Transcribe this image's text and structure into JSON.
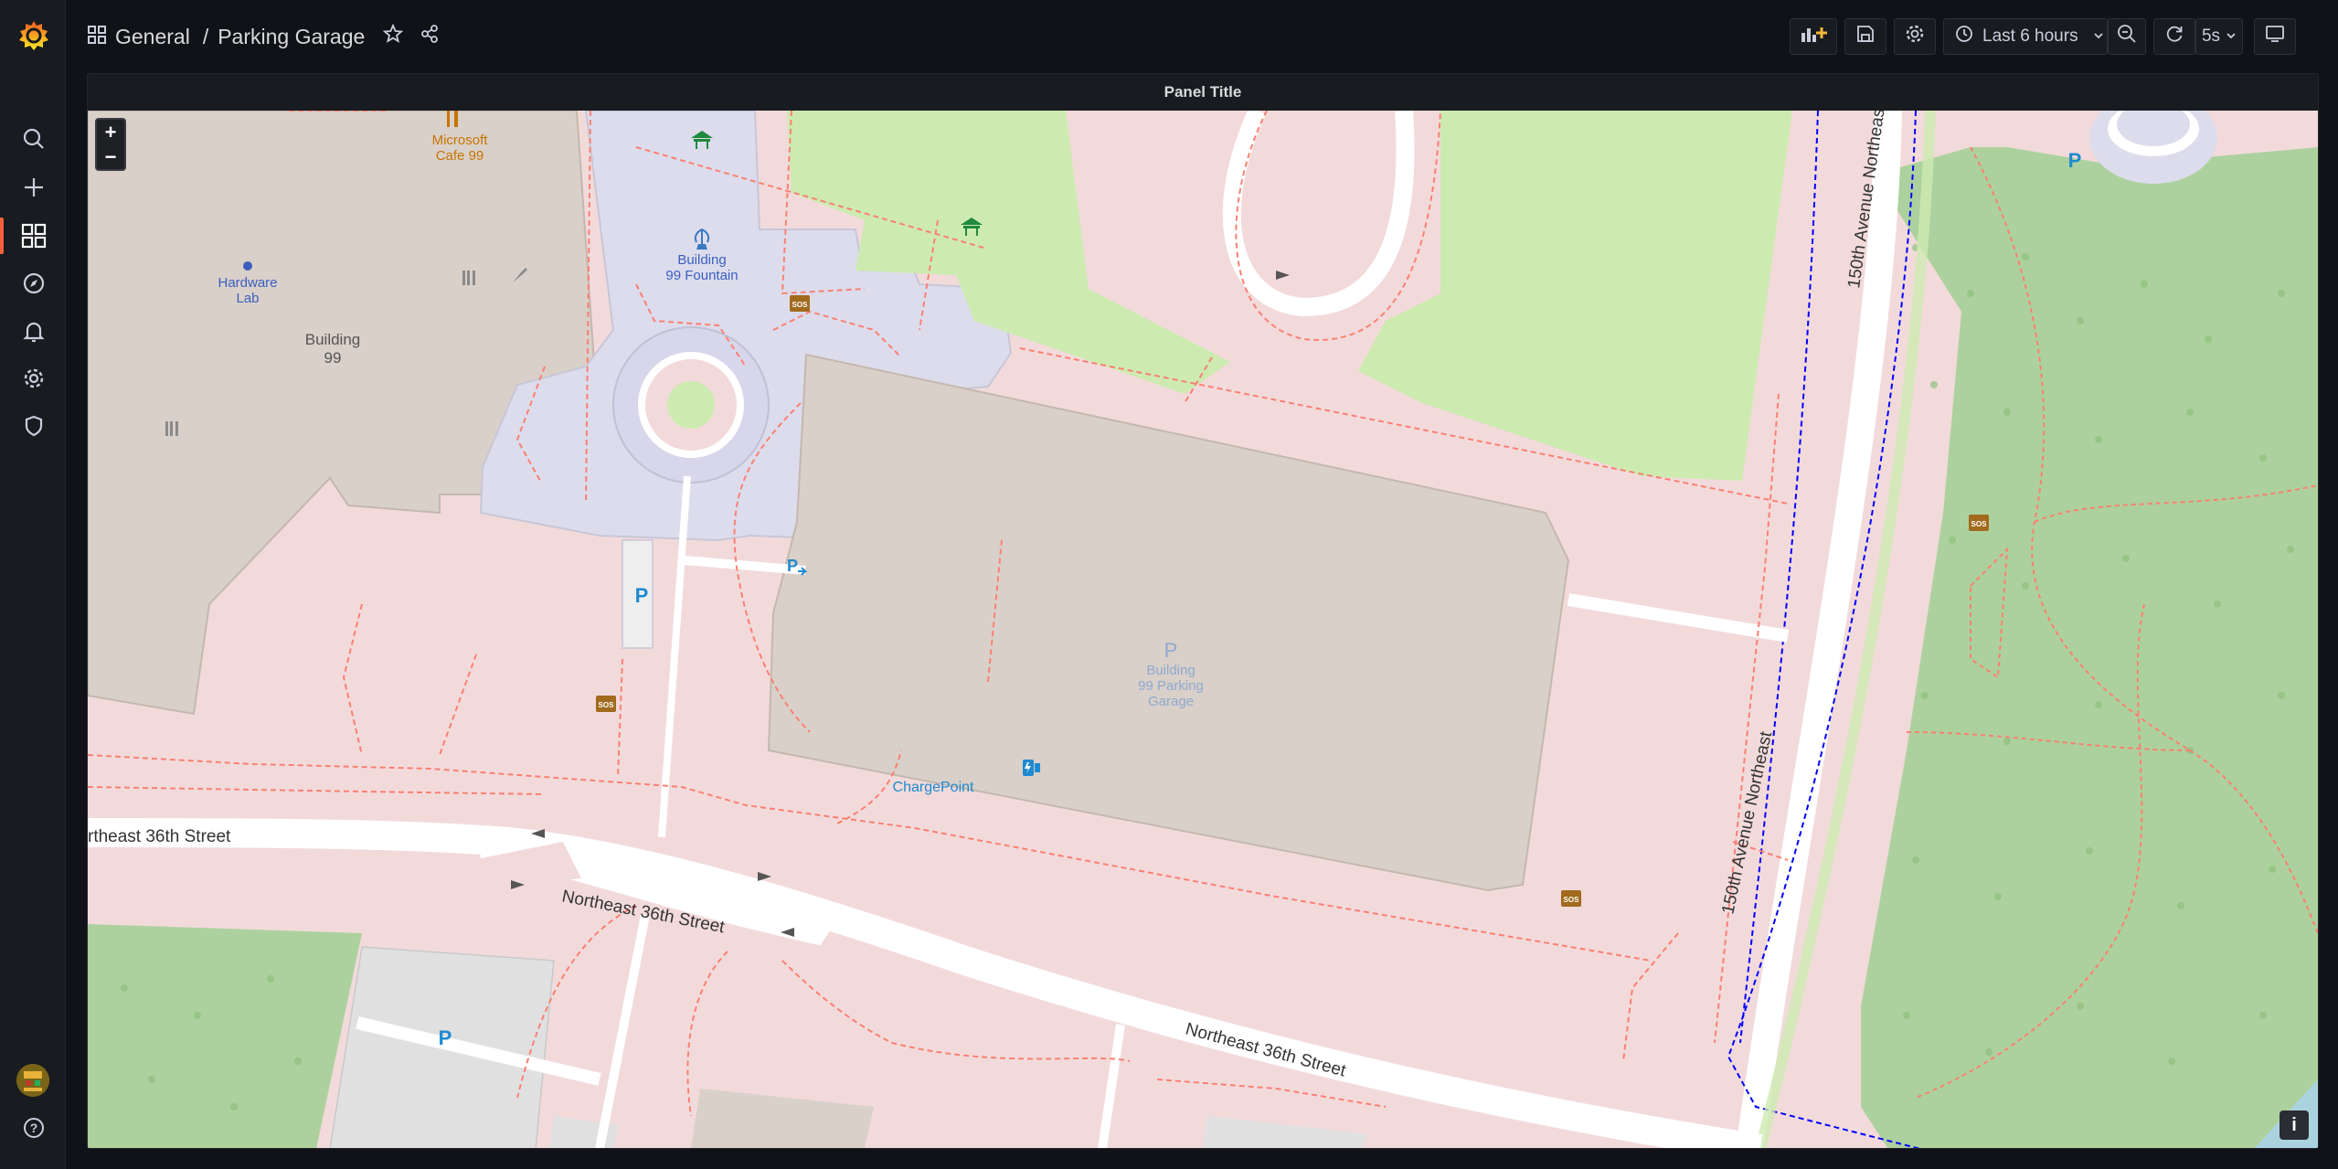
{
  "breadcrumb": {
    "folder": "General",
    "separator": "/",
    "dashboard": "Parking Garage"
  },
  "toolbar": {
    "time_range": "Last 6 hours",
    "refresh_interval": "5s"
  },
  "panel": {
    "title": "Panel Title"
  },
  "map": {
    "zoom_in": "+",
    "zoom_out": "−",
    "attribution": "i",
    "labels": {
      "microsoft_cafe_1": "Microsoft",
      "microsoft_cafe_2": "Cafe 99",
      "hardware_lab_1": "Hardware",
      "hardware_lab_2": "Lab",
      "building_99_1": "Building",
      "building_99_2": "99",
      "fountain_1": "Building",
      "fountain_2": "99 Fountain",
      "garage_p": "P",
      "garage_1": "Building",
      "garage_2": "99 Parking",
      "garage_3": "Garage",
      "chargepoint": "ChargePoint",
      "street_ne36_west": "rtheast 36th Street",
      "street_ne36_mid": "Northeast 36th Street",
      "street_ne36_east": "Northeast 36th Street",
      "avenue_150_north": "150th Avenue Northeast",
      "avenue_150_south": "150th Avenue Northeast",
      "parking_p": "P",
      "sos": "SOS"
    }
  },
  "colors": {
    "accent": "#f55f3e",
    "map_background": "#f2dadb",
    "grass": "#cdebb0",
    "park": "#add19e",
    "building": "#d9d0c9",
    "footway": "#fa8072",
    "road": "#ffffff",
    "cycleway": "#0000ff"
  },
  "icons": [
    "grafana-logo",
    "dashboard-grid-icon",
    "star-icon",
    "share-icon",
    "search-icon",
    "plus-icon",
    "dashboards-icon",
    "compass-icon",
    "bell-icon",
    "gear-icon",
    "shield-icon",
    "help-icon",
    "add-panel-icon",
    "save-icon",
    "settings-icon",
    "clock-icon",
    "chevron-down-icon",
    "zoom-out-icon",
    "refresh-icon",
    "tv-icon"
  ]
}
